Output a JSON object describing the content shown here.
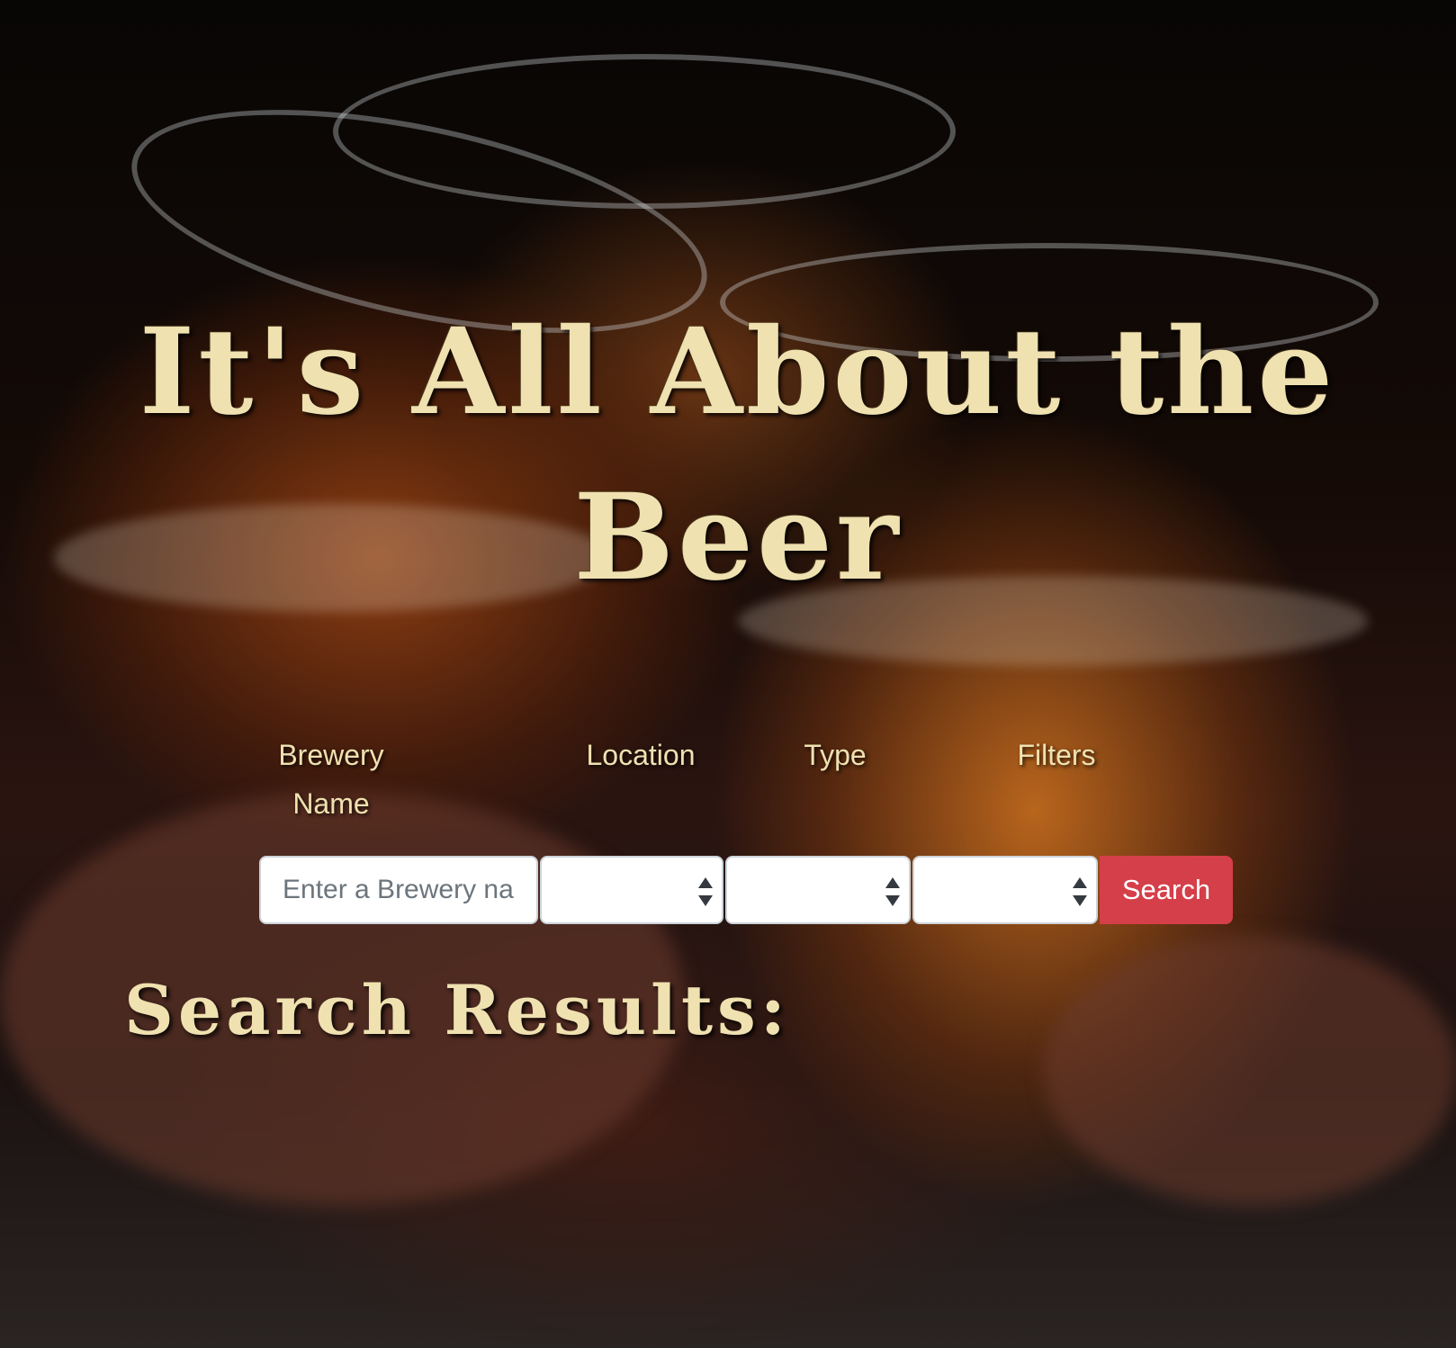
{
  "header": {
    "title": "It's All About the Beer"
  },
  "search_form": {
    "labels": {
      "brewery_name": "Brewery Name",
      "location": "Location",
      "type": "Type",
      "filters": "Filters"
    },
    "brewery_input": {
      "placeholder": "Enter a Brewery name",
      "value": ""
    },
    "location_select": {
      "selected": ""
    },
    "type_select": {
      "selected": ""
    },
    "filters_select": {
      "selected": ""
    },
    "search_label": "Search"
  },
  "results": {
    "heading": "Search Results:",
    "items": []
  },
  "colors": {
    "title_text": "#efe1b0",
    "search_button": "#d53f49",
    "input_border": "#ced4da"
  }
}
